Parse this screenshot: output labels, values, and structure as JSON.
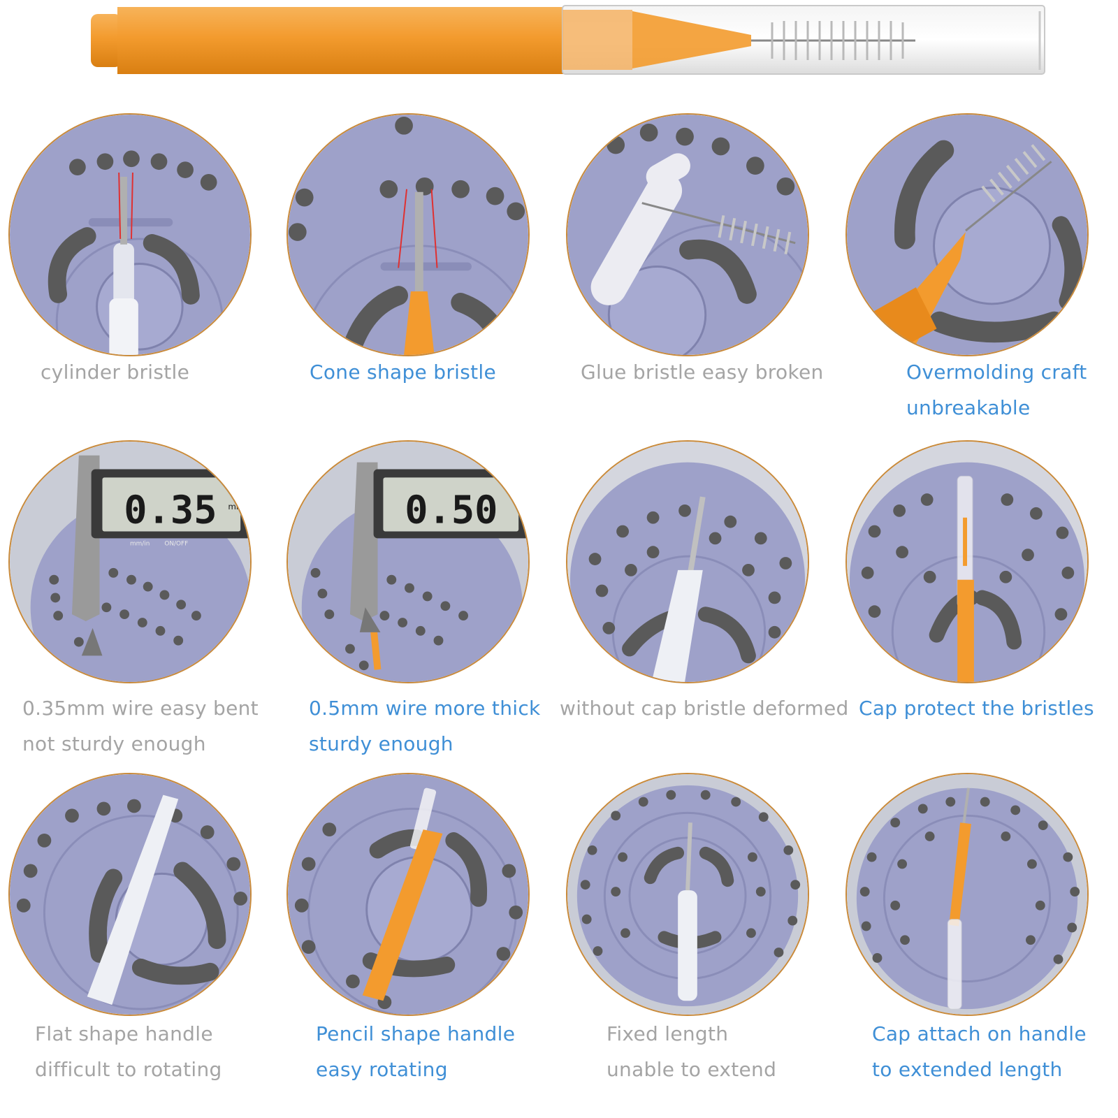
{
  "colors": {
    "orange": "#f39b2e",
    "caption_good": "#3f8fd6",
    "caption_bad": "#a4a4a4",
    "showerhead": "#9ea1c9",
    "nozzle": "#5a5a5a"
  },
  "comparisons": [
    {
      "row": "bristle",
      "bad": {
        "photo": "cylinder-bristle-photo",
        "lines": [
          "cylinder bristle"
        ]
      },
      "good": {
        "photo": "cone-bristle-photo",
        "lines": [
          "Cone shape bristle"
        ]
      }
    },
    {
      "row": "bonding",
      "bad": {
        "photo": "glue-bristle-photo",
        "lines": [
          "Glue bristle easy broken"
        ]
      },
      "good": {
        "photo": "overmolding-photo",
        "lines": [
          "Overmolding craft",
          "unbreakable"
        ]
      }
    },
    {
      "row": "wire",
      "bad": {
        "photo": "caliper-035-photo",
        "lines": [
          "0.35mm wire easy bent",
          "not sturdy enough"
        ],
        "display": "0.35"
      },
      "good": {
        "photo": "caliper-050-photo",
        "lines": [
          "0.5mm wire more thick",
          "sturdy enough"
        ],
        "display": "0.50"
      }
    },
    {
      "row": "cap",
      "bad": {
        "photo": "no-cap-photo",
        "lines": [
          "without cap bristle deformed"
        ]
      },
      "good": {
        "photo": "cap-photo",
        "lines": [
          "Cap protect the bristles"
        ]
      }
    },
    {
      "row": "handle",
      "bad": {
        "photo": "flat-handle-photo",
        "lines": [
          "Flat shape handle",
          "difficult to rotating"
        ]
      },
      "good": {
        "photo": "pencil-handle-photo",
        "lines": [
          "Pencil shape handle",
          "easy rotating"
        ]
      }
    },
    {
      "row": "length",
      "bad": {
        "photo": "fixed-length-photo",
        "lines": [
          "Fixed length",
          "unable to extend"
        ]
      },
      "good": {
        "photo": "extended-length-photo",
        "lines": [
          "Cap attach on handle",
          "to extended length"
        ]
      }
    }
  ],
  "caliper_units": {
    "unit": "mm",
    "mode": "mm/in",
    "power": "ON/OFF"
  }
}
